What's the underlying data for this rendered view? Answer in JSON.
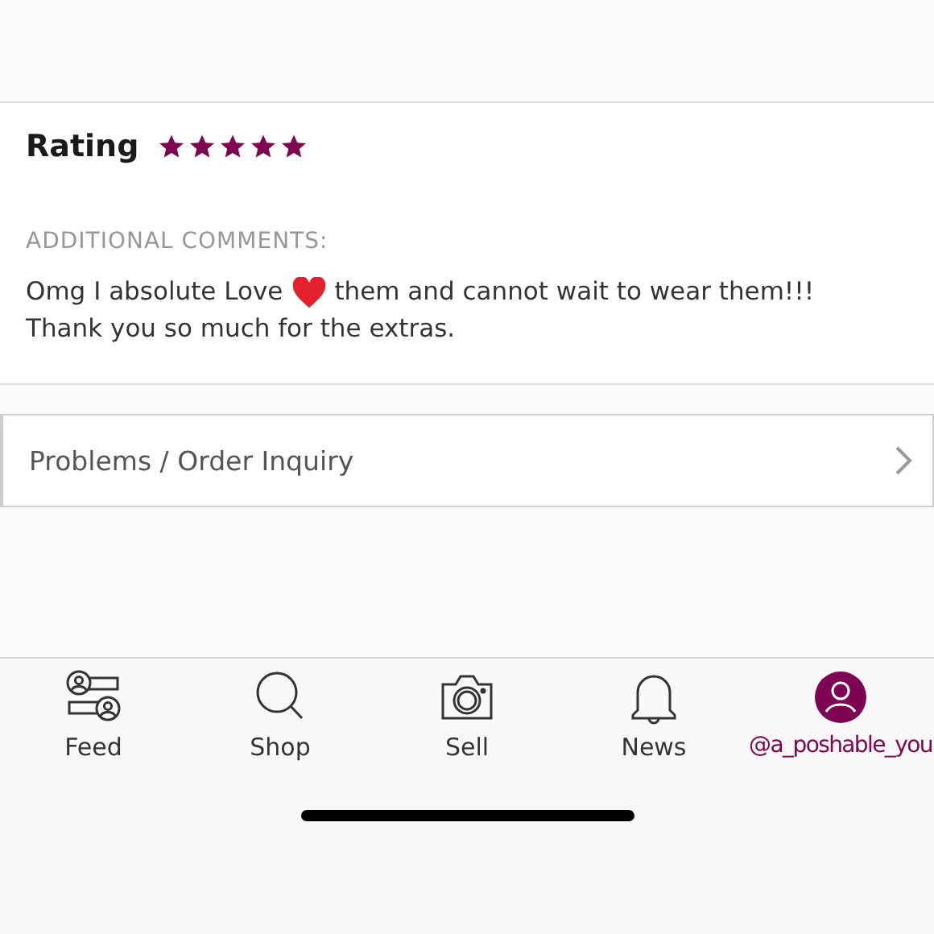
{
  "rating": {
    "label": "Rating",
    "stars": 5
  },
  "comments": {
    "heading": "ADDITIONAL COMMENTS:",
    "text_before": "Omg I absolute Love",
    "text_after": "them and cannot wait to wear them!!!",
    "text_line2": "Thank you so much for the extras."
  },
  "inquiry": {
    "label": "Problems / Order Inquiry"
  },
  "tabs": [
    {
      "label": "Feed",
      "kind": "feed",
      "selected": false
    },
    {
      "label": "Shop",
      "kind": "shop",
      "selected": false
    },
    {
      "label": "Sell",
      "kind": "sell",
      "selected": false
    },
    {
      "label": "News",
      "kind": "news",
      "selected": false
    },
    {
      "label": "@a_poshable_you",
      "kind": "account",
      "selected": true
    }
  ]
}
